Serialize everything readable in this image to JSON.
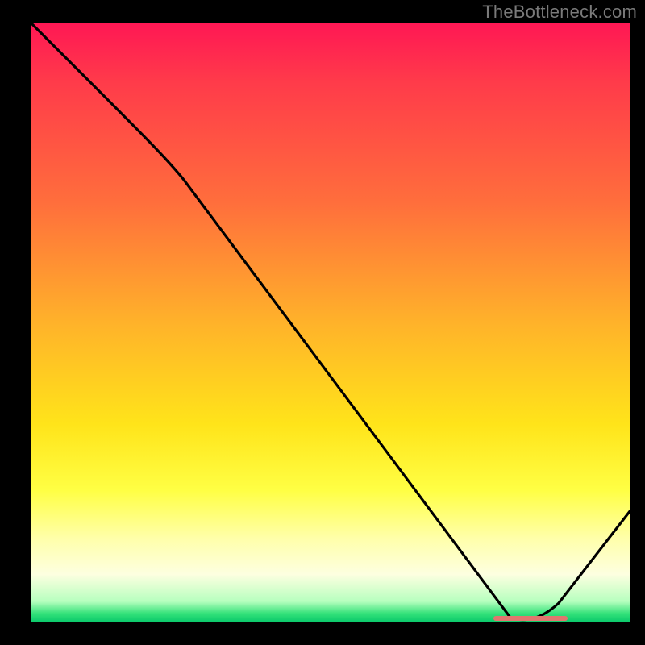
{
  "watermark": "TheBottleneck.com",
  "chart_data": {
    "type": "line",
    "title": "",
    "xlabel": "",
    "ylabel": "",
    "xlim": [
      0,
      100
    ],
    "ylim": [
      0,
      100
    ],
    "x": [
      0,
      8,
      25,
      40,
      55,
      70,
      80,
      85,
      90,
      100
    ],
    "values": [
      100,
      92,
      78,
      56,
      35,
      14,
      3,
      0,
      4,
      18
    ],
    "marker": {
      "x_start": 78,
      "x_end": 91,
      "y": 0.5
    },
    "gradient_colors": {
      "top": "#ff1754",
      "mid": "#ffe41a",
      "bottom": "#08c86a"
    }
  }
}
